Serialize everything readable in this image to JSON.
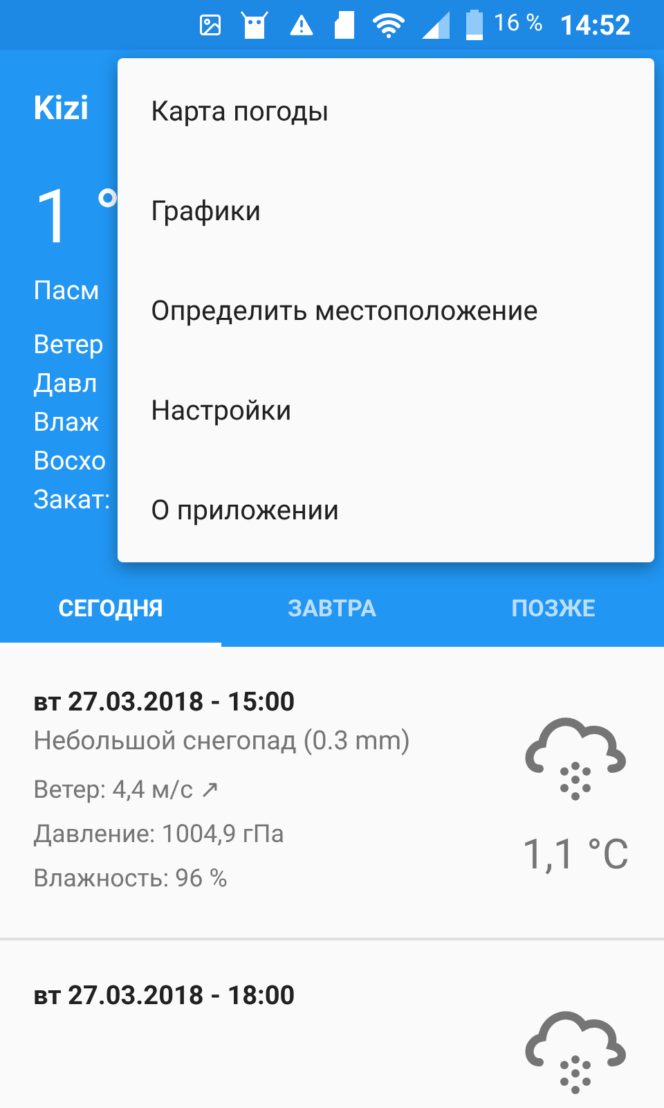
{
  "status_bar": {
    "battery": "16 %",
    "time": "14:52"
  },
  "header": {
    "city": "Kizi",
    "temperature": "1 °",
    "condition": "Пасм",
    "details": [
      "Ветер",
      "Давл",
      "Влаж",
      "Восхо",
      "Закат:"
    ]
  },
  "tabs": [
    {
      "label": "СЕГОДНЯ",
      "selected": true
    },
    {
      "label": "ЗАВТРА",
      "selected": false
    },
    {
      "label": "ПОЗЖЕ",
      "selected": false
    }
  ],
  "forecast": [
    {
      "date": "вт 27.03.2018 - 15:00",
      "description": "Небольшой снегопад (0.3 mm)",
      "wind": "Ветер: 4,4 м/с ↗",
      "pressure": "Давление: 1004,9 гПа",
      "humidity": "Влажность: 96 %",
      "temperature": "1,1 °C"
    },
    {
      "date": "вт 27.03.2018 - 18:00"
    }
  ],
  "menu": {
    "items": [
      "Карта погоды",
      "Графики",
      "Определить местоположение",
      "Настройки",
      "О приложении"
    ]
  }
}
